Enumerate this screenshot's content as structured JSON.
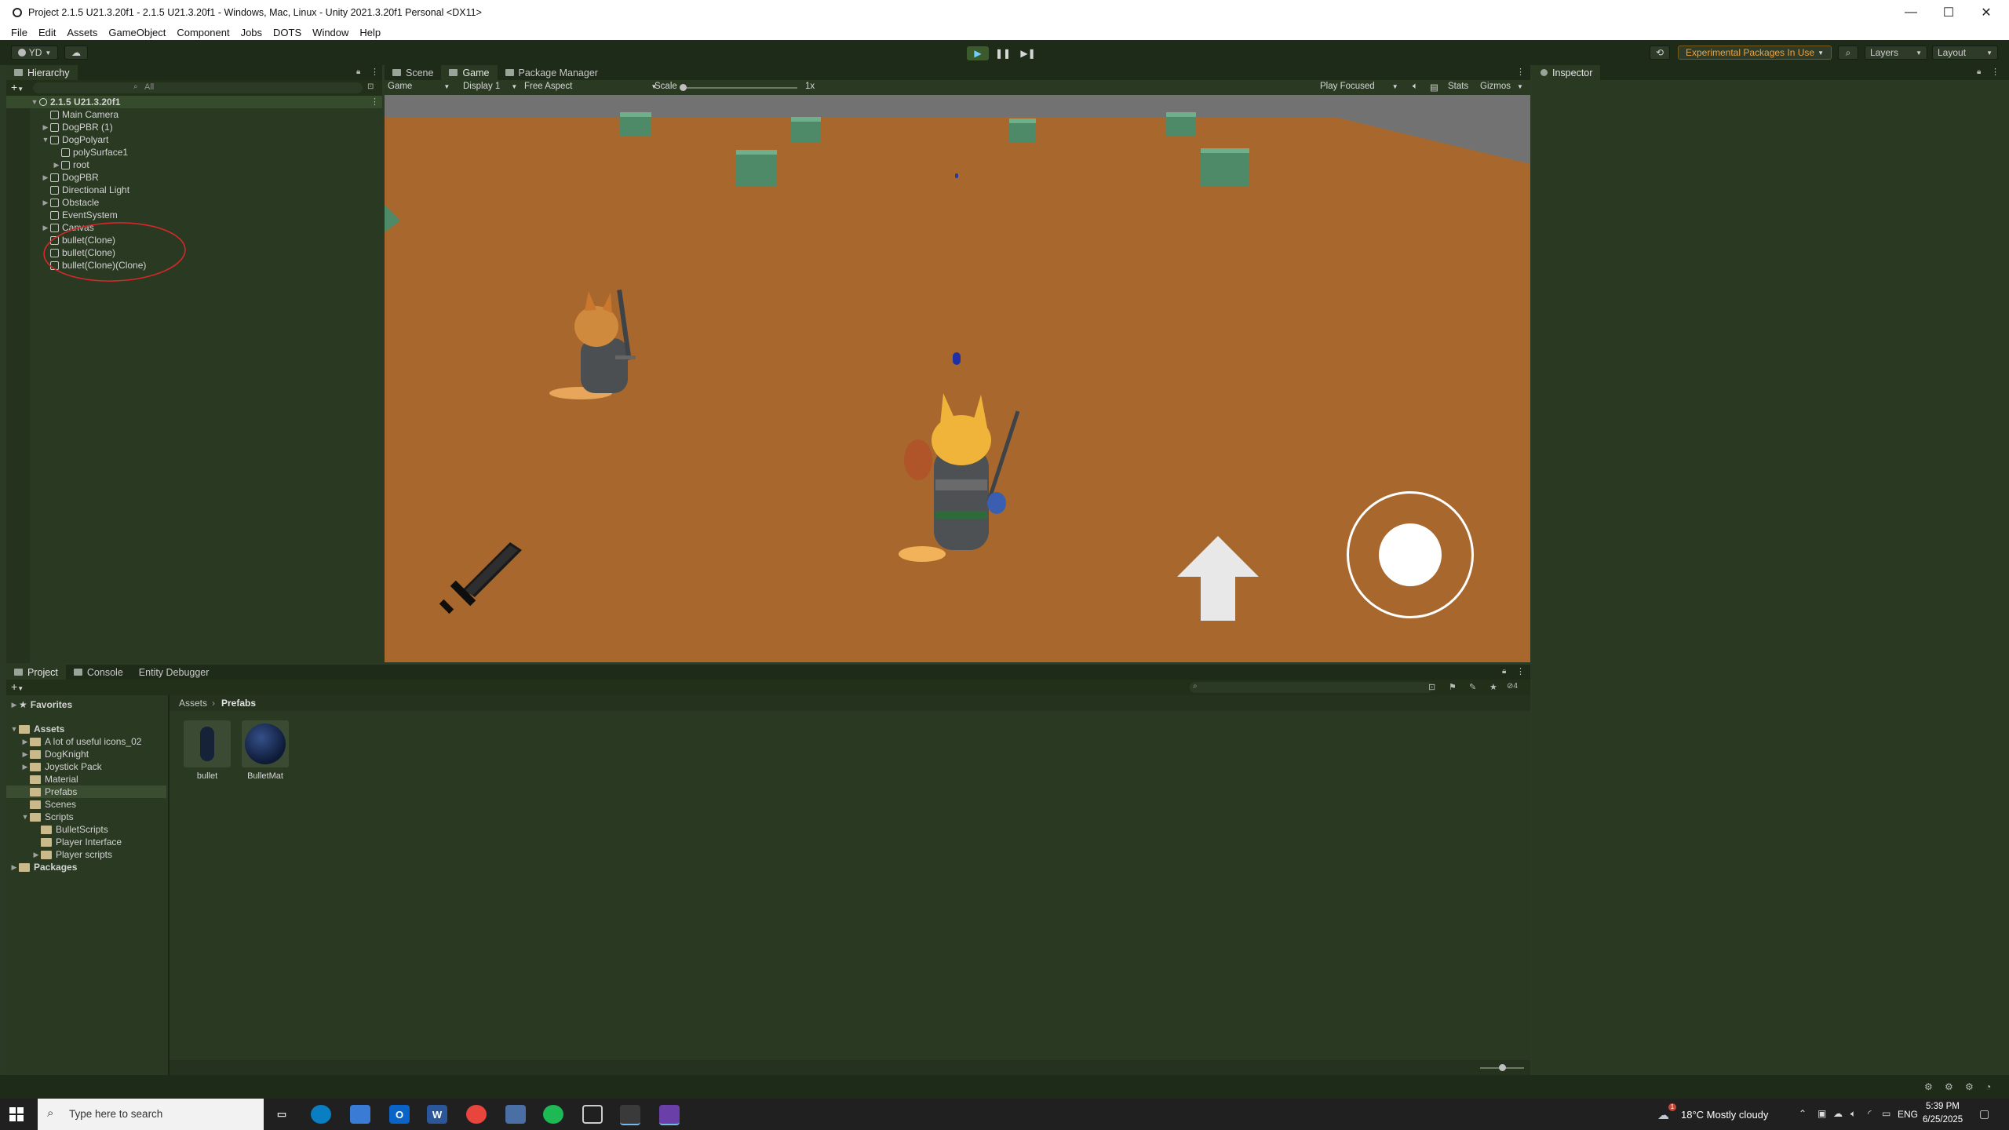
{
  "window": {
    "title": "Project 2.1.5 U21.3.20f1 - 2.1.5 U21.3.20f1 - Windows, Mac, Linux - Unity 2021.3.20f1 Personal <DX11>",
    "minimize": "—",
    "maximize": "☐",
    "close": "✕"
  },
  "menu": [
    "File",
    "Edit",
    "Assets",
    "GameObject",
    "Component",
    "Jobs",
    "DOTS",
    "Window",
    "Help"
  ],
  "toolbar": {
    "account": "YD",
    "experimental": "Experimental Packages In Use",
    "layers": "Layers",
    "layout": "Layout"
  },
  "hierarchy": {
    "tab": "Hierarchy",
    "search_placeholder": "All",
    "scene": "2.1.5 U21.3.20f1",
    "items": [
      {
        "label": "Main Camera"
      },
      {
        "label": "DogPBR (1)"
      },
      {
        "label": "DogPolyart"
      },
      {
        "label": "polySurface1"
      },
      {
        "label": "root"
      },
      {
        "label": "DogPBR"
      },
      {
        "label": "Directional Light"
      },
      {
        "label": "Obstacle"
      },
      {
        "label": "EventSystem"
      },
      {
        "label": "Canvas"
      },
      {
        "label": "bullet(Clone)"
      },
      {
        "label": "bullet(Clone)"
      },
      {
        "label": "bullet(Clone)(Clone)"
      }
    ]
  },
  "center": {
    "tabs": [
      "Scene",
      "Game",
      "Package Manager"
    ],
    "game_dropdown": "Game",
    "display": "Display 1",
    "aspect": "Free Aspect",
    "scale_label": "Scale",
    "scale_value": "1x",
    "play_focused": "Play Focused",
    "stats": "Stats",
    "gizmos": "Gizmos"
  },
  "inspector": {
    "tab": "Inspector"
  },
  "project": {
    "tabs": [
      "Project",
      "Console",
      "Entity Debugger"
    ],
    "favorites": "Favorites",
    "assets": "Assets",
    "folders": [
      "A lot of useful icons_02",
      "DogKnight",
      "Joystick Pack",
      "Material",
      "Prefabs",
      "Scenes",
      "Scripts",
      "BulletScripts",
      "Player Interface",
      "Player scripts"
    ],
    "packages": "Packages",
    "breadcrumb_root": "Assets",
    "breadcrumb_current": "Prefabs",
    "hidden_count": "4",
    "items": [
      {
        "label": "bullet"
      },
      {
        "label": "BulletMat"
      }
    ]
  },
  "taskbar": {
    "search_placeholder": "Type here to search",
    "weather": "18°C  Mostly cloudy",
    "lang": "ENG",
    "time": "5:39 PM",
    "date": "6/25/2025",
    "notification_badge": "1"
  }
}
